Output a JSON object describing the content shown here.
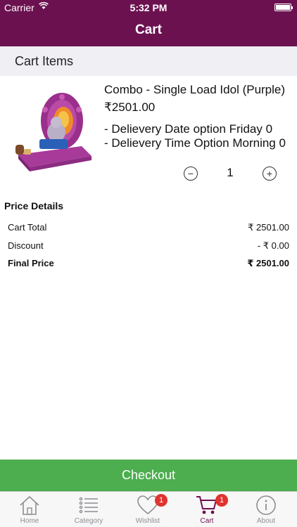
{
  "status_bar": {
    "carrier": "Carrier",
    "time": "5:32 PM",
    "battery_level": 1.0
  },
  "header": {
    "title": "Cart"
  },
  "section": {
    "title": "Cart Items"
  },
  "cart_item": {
    "name": "Combo - Single Load Idol (Purple)",
    "price": "₹2501.00",
    "options": [
      "- Delievery Date option Friday 0",
      "- Delievery Time Option Morning 0"
    ],
    "decrement_symbol": "−",
    "increment_symbol": "+",
    "quantity": "1"
  },
  "price_details": {
    "title": "Price Details",
    "rows": [
      {
        "label": "Cart Total",
        "value": "₹ 2501.00"
      },
      {
        "label": "Discount",
        "value": "- ₹ 0.00"
      },
      {
        "label": "Final Price",
        "value": "₹ 2501.00"
      }
    ]
  },
  "checkout": {
    "label": "Checkout"
  },
  "tab_bar": {
    "items": [
      {
        "label": "Home",
        "icon": "home-icon"
      },
      {
        "label": "Category",
        "icon": "list-icon"
      },
      {
        "label": "Wishlist",
        "icon": "heart-icon",
        "badge": "1"
      },
      {
        "label": "Cart",
        "icon": "cart-icon",
        "badge": "1",
        "active": true
      },
      {
        "label": "About",
        "icon": "info-icon"
      }
    ]
  },
  "colors": {
    "brand": "#6c1150",
    "checkout": "#4cae4f",
    "badge": "#e0332f"
  }
}
